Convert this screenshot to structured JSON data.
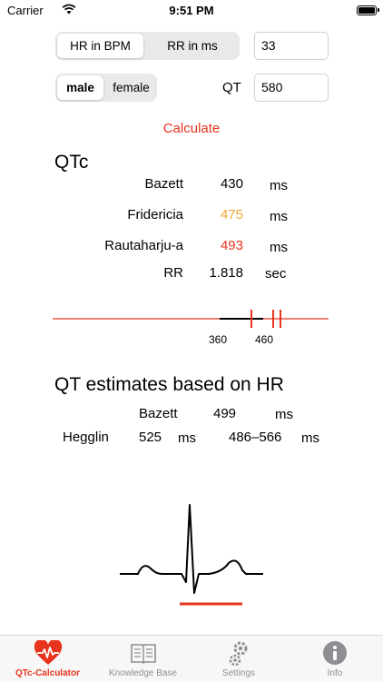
{
  "status_bar": {
    "carrier": "Carrier",
    "time": "9:51 PM"
  },
  "hr_mode": {
    "options": [
      "HR in BPM",
      "RR in ms"
    ],
    "selected": "HR in BPM"
  },
  "hr_input": {
    "value": "33"
  },
  "sex": {
    "options": [
      "male",
      "female"
    ],
    "selected": "male"
  },
  "qt": {
    "label": "QT",
    "value": "580"
  },
  "calculate_label": "Calculate",
  "qtc": {
    "title": "QTc",
    "rows": [
      {
        "name": "Bazett",
        "value": "430",
        "unit": "ms",
        "color": "#000000"
      },
      {
        "name": "Fridericia",
        "value": "475",
        "unit": "ms",
        "color": "#f2a92f"
      },
      {
        "name": "Rautaharju-a",
        "value": "493",
        "unit": "ms",
        "color": "#e8341d"
      },
      {
        "name": "RR",
        "value": "1.818",
        "unit": "sec",
        "color": "#000000"
      }
    ]
  },
  "scale": {
    "tick_labels": [
      "360",
      "460"
    ],
    "colors": {
      "line": "#e8341d",
      "range": "#000000"
    }
  },
  "estimates": {
    "title": "QT estimates based on HR",
    "bazett": {
      "name": "Bazett",
      "value": "499",
      "unit": "ms"
    },
    "hegglin": {
      "name": "Hegglin",
      "value": "525",
      "unit": "ms",
      "range": "486–566",
      "range_unit": "ms"
    }
  },
  "tabs": [
    {
      "label": "QTc-Calculator",
      "icon": "heart-pulse-icon",
      "active": true
    },
    {
      "label": "Knowledge Base",
      "icon": "book-icon",
      "active": false
    },
    {
      "label": "Settings",
      "icon": "gear-icon",
      "active": false
    },
    {
      "label": "Info",
      "icon": "info-icon",
      "active": false
    }
  ],
  "colors": {
    "accent": "#e8341d",
    "warning": "#f2a92f"
  }
}
